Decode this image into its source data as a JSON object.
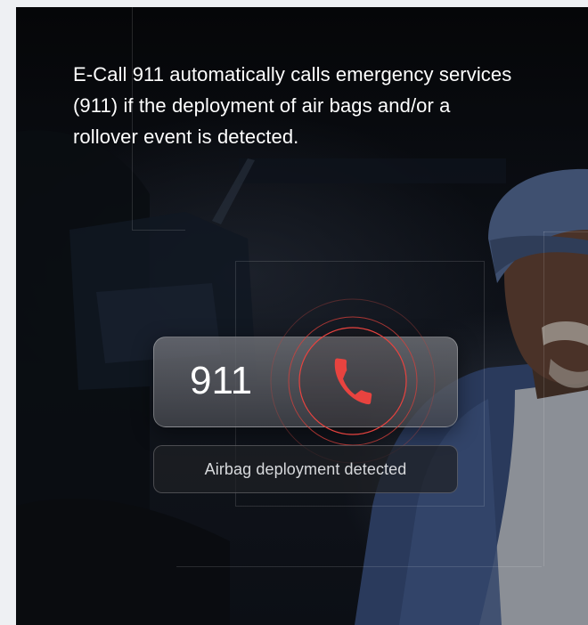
{
  "hero": {
    "description": "E-Call 911 automatically calls emergency services (911) if the deployment of air bags and/or a rollover event is detected."
  },
  "call_card": {
    "number": "911",
    "icon": "phone-icon",
    "accent_color": "#e8433f"
  },
  "status": {
    "text": "Airbag deployment detected"
  }
}
